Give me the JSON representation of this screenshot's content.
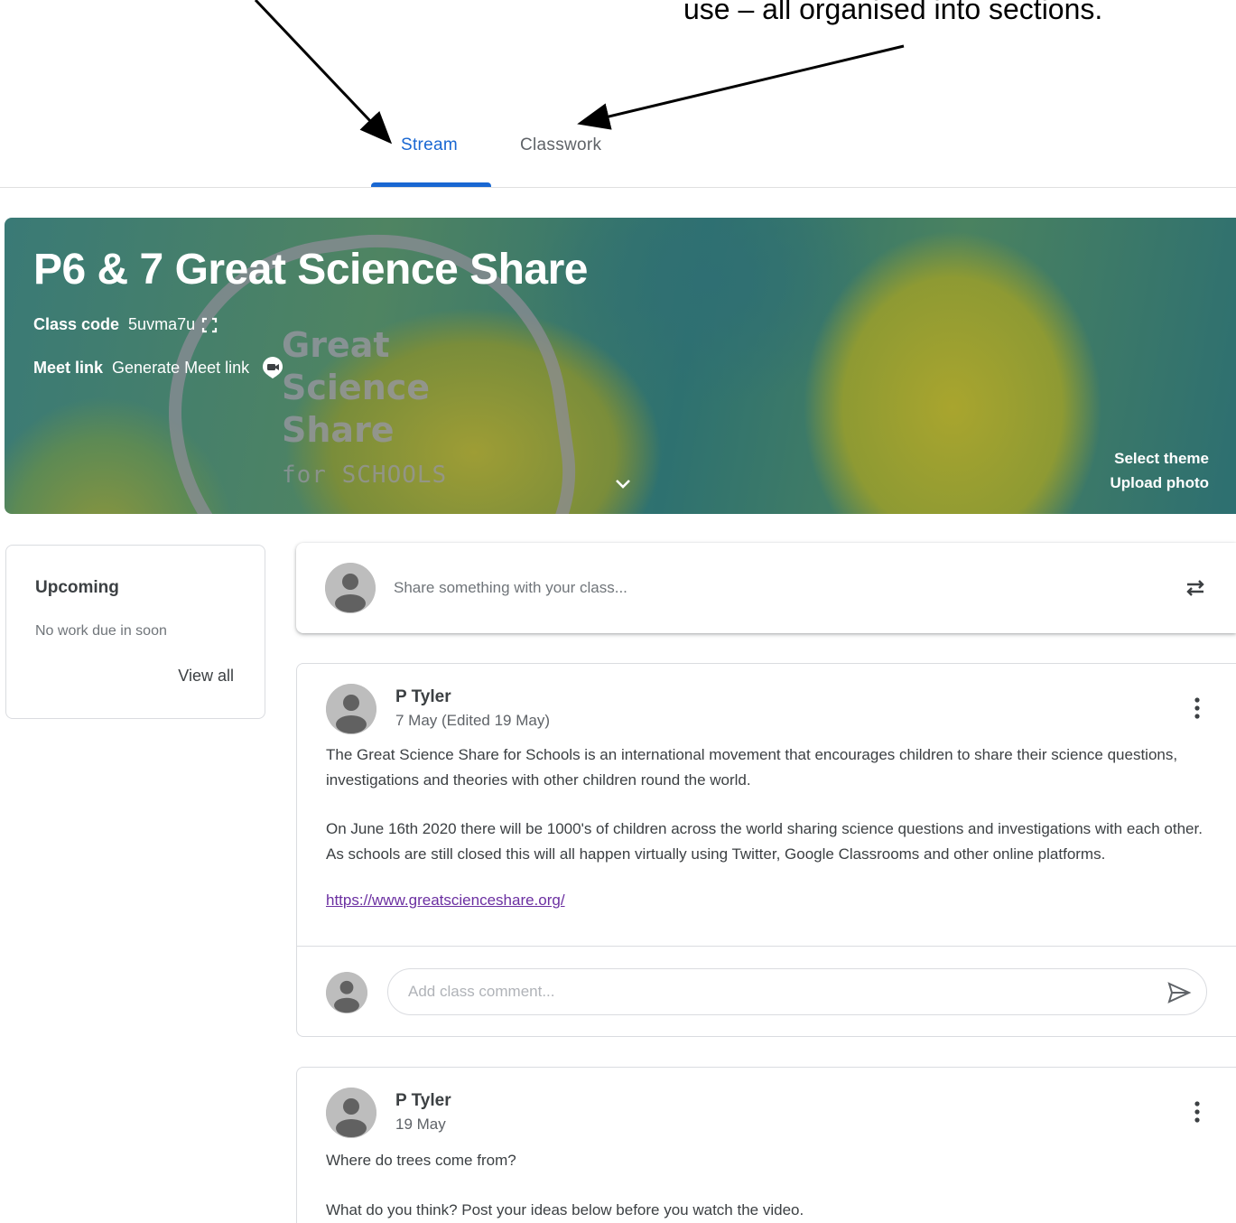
{
  "annotation": {
    "text": "use – all organised into sections."
  },
  "tabs": [
    {
      "label": "Stream",
      "active": true
    },
    {
      "label": "Classwork",
      "active": false
    }
  ],
  "banner": {
    "title": "P6 & 7 Great Science Share",
    "class_code_label": "Class code",
    "class_code_value": "5uvma7u",
    "meet_label": "Meet link",
    "meet_value": "Generate Meet link",
    "logo_lines": [
      "Great",
      "Science",
      "Share"
    ],
    "logo_sub": "for SCHOOLS",
    "select_theme": "Select theme",
    "upload_photo": "Upload photo"
  },
  "upcoming": {
    "title": "Upcoming",
    "empty_text": "No work due in soon",
    "view_all": "View all"
  },
  "share": {
    "placeholder": "Share something with your class..."
  },
  "posts": [
    {
      "author": "P Tyler",
      "date": "7 May (Edited 19 May)",
      "paragraphs": [
        "The Great Science Share for Schools is an international movement that encourages children to share their science questions, investigations and theories with other children round the world.",
        "On June 16th 2020 there will be 1000's of children across the world sharing science questions and investigations with each other. As schools are still closed this will all happen virtually using Twitter, Google Classrooms and other online platforms."
      ],
      "link": "https://www.greatscienceshare.org/",
      "comment_placeholder": "Add class comment..."
    },
    {
      "author": "P Tyler",
      "date": "19 May",
      "paragraphs": [
        "Where do trees come from?",
        "What do you think? Post your ideas below before you watch the video."
      ]
    }
  ],
  "colors": {
    "accent": "#1967d2",
    "link": "#6b2fa1"
  },
  "icons": {
    "copy_code": "fullscreen-icon",
    "meet": "meet-video-icon",
    "expand": "chevron-down-icon",
    "repost": "repost-icon",
    "more": "more-vert-icon",
    "send": "send-icon",
    "avatar": "account-avatar-icon"
  }
}
